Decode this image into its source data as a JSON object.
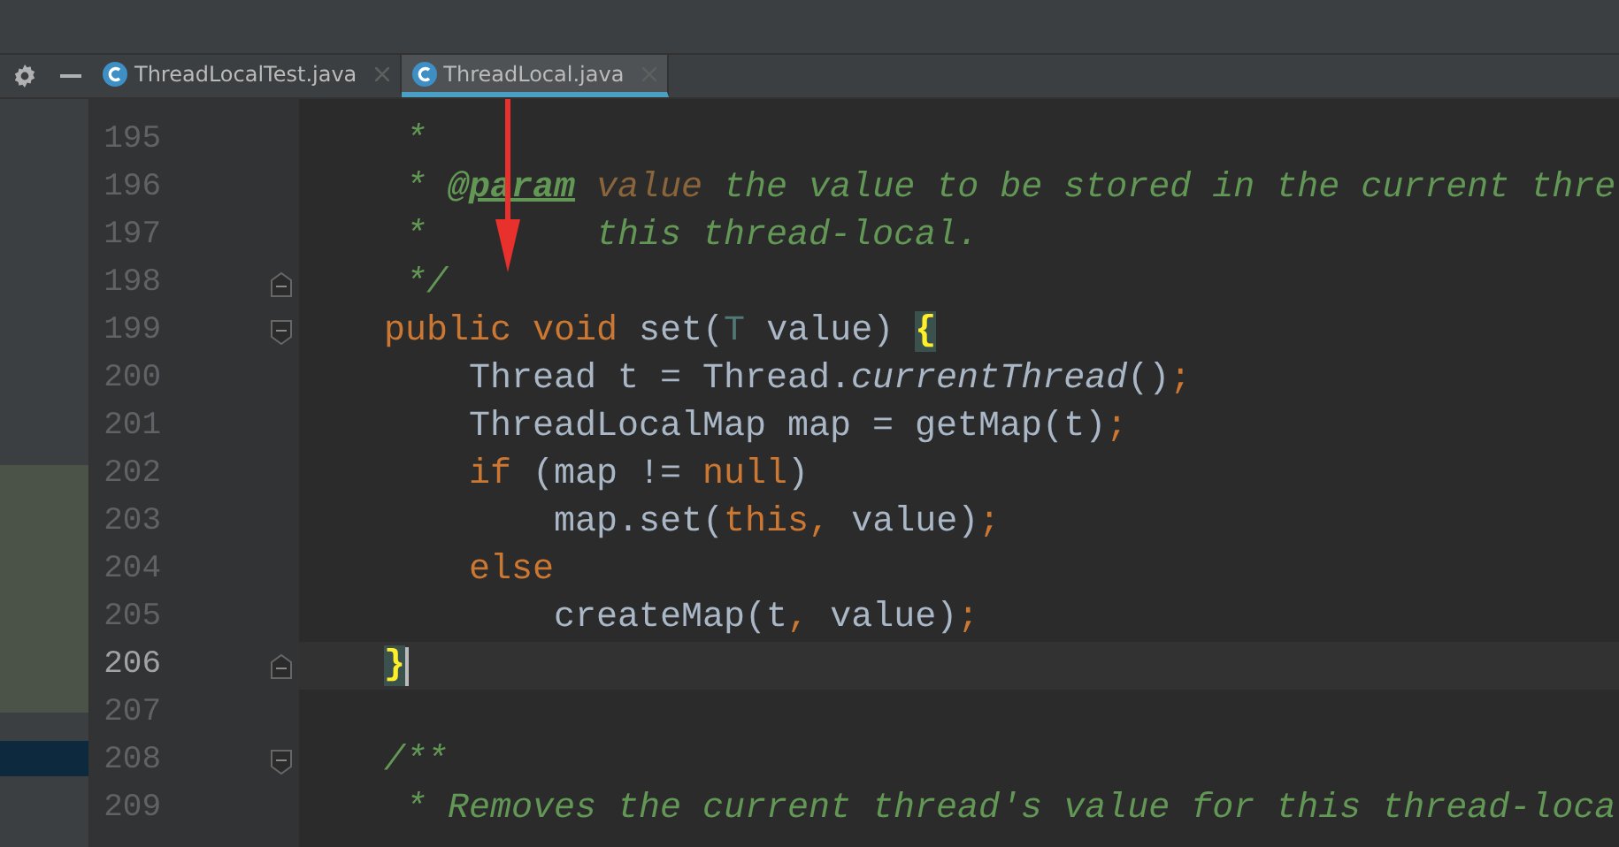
{
  "tabs": [
    {
      "label": "ThreadLocalTest.java",
      "selected": false
    },
    {
      "label": "ThreadLocal.java",
      "selected": true
    }
  ],
  "editor": {
    "lines": [
      {
        "number": "195",
        "current": false,
        "tokens": [
          {
            "kind": "comment",
            "text": " *"
          }
        ]
      },
      {
        "number": "196",
        "current": false,
        "tokens": [
          {
            "kind": "comment",
            "text": " * "
          },
          {
            "kind": "doc-tag",
            "text": "@param"
          },
          {
            "kind": "doc-param",
            "text": " value"
          },
          {
            "kind": "comment",
            "text": " the value to be stored in the current thre"
          }
        ]
      },
      {
        "number": "197",
        "current": false,
        "tokens": [
          {
            "kind": "comment",
            "text": " *        this thread-local."
          }
        ]
      },
      {
        "number": "198",
        "current": false,
        "fold_end": true,
        "tokens": [
          {
            "kind": "comment",
            "text": " */"
          }
        ]
      },
      {
        "number": "199",
        "current": false,
        "fold_start": true,
        "tokens": [
          {
            "kind": "keyword",
            "text": "public void "
          },
          {
            "kind": "plain",
            "text": "set("
          },
          {
            "kind": "type-param",
            "text": "T"
          },
          {
            "kind": "plain",
            "text": " value) "
          },
          {
            "kind": "brace-match",
            "text": "{"
          }
        ]
      },
      {
        "number": "200",
        "current": false,
        "tokens": [
          {
            "kind": "plain",
            "text": "    Thread t = Thread."
          },
          {
            "kind": "static-call",
            "text": "currentThread"
          },
          {
            "kind": "plain",
            "text": "()"
          },
          {
            "kind": "punct",
            "text": ";"
          }
        ]
      },
      {
        "number": "201",
        "current": false,
        "tokens": [
          {
            "kind": "plain",
            "text": "    ThreadLocalMap map = getMap(t)"
          },
          {
            "kind": "punct",
            "text": ";"
          }
        ]
      },
      {
        "number": "202",
        "current": false,
        "tokens": [
          {
            "kind": "keyword",
            "text": "    if "
          },
          {
            "kind": "plain",
            "text": "(map != "
          },
          {
            "kind": "keyword",
            "text": "null"
          },
          {
            "kind": "plain",
            "text": ")"
          }
        ]
      },
      {
        "number": "203",
        "current": false,
        "tokens": [
          {
            "kind": "plain",
            "text": "        map.set("
          },
          {
            "kind": "keyword",
            "text": "this"
          },
          {
            "kind": "punct",
            "text": ","
          },
          {
            "kind": "plain",
            "text": " value)"
          },
          {
            "kind": "punct",
            "text": ";"
          }
        ]
      },
      {
        "number": "204",
        "current": false,
        "tokens": [
          {
            "kind": "keyword",
            "text": "    else"
          }
        ]
      },
      {
        "number": "205",
        "current": false,
        "tokens": [
          {
            "kind": "plain",
            "text": "        createMap(t"
          },
          {
            "kind": "punct",
            "text": ","
          },
          {
            "kind": "plain",
            "text": " value)"
          },
          {
            "kind": "punct",
            "text": ";"
          }
        ]
      },
      {
        "number": "206",
        "current": true,
        "fold_end": true,
        "tokens": [
          {
            "kind": "brace-match",
            "text": "}"
          }
        ]
      },
      {
        "number": "207",
        "current": false
      },
      {
        "number": "208",
        "current": false,
        "fold_start": true,
        "tokens": [
          {
            "kind": "comment",
            "text": "/**"
          }
        ]
      },
      {
        "number": "209",
        "current": false,
        "tokens": [
          {
            "kind": "comment",
            "text": " * Removes the current thread's value for this thread-loca"
          }
        ]
      }
    ]
  }
}
